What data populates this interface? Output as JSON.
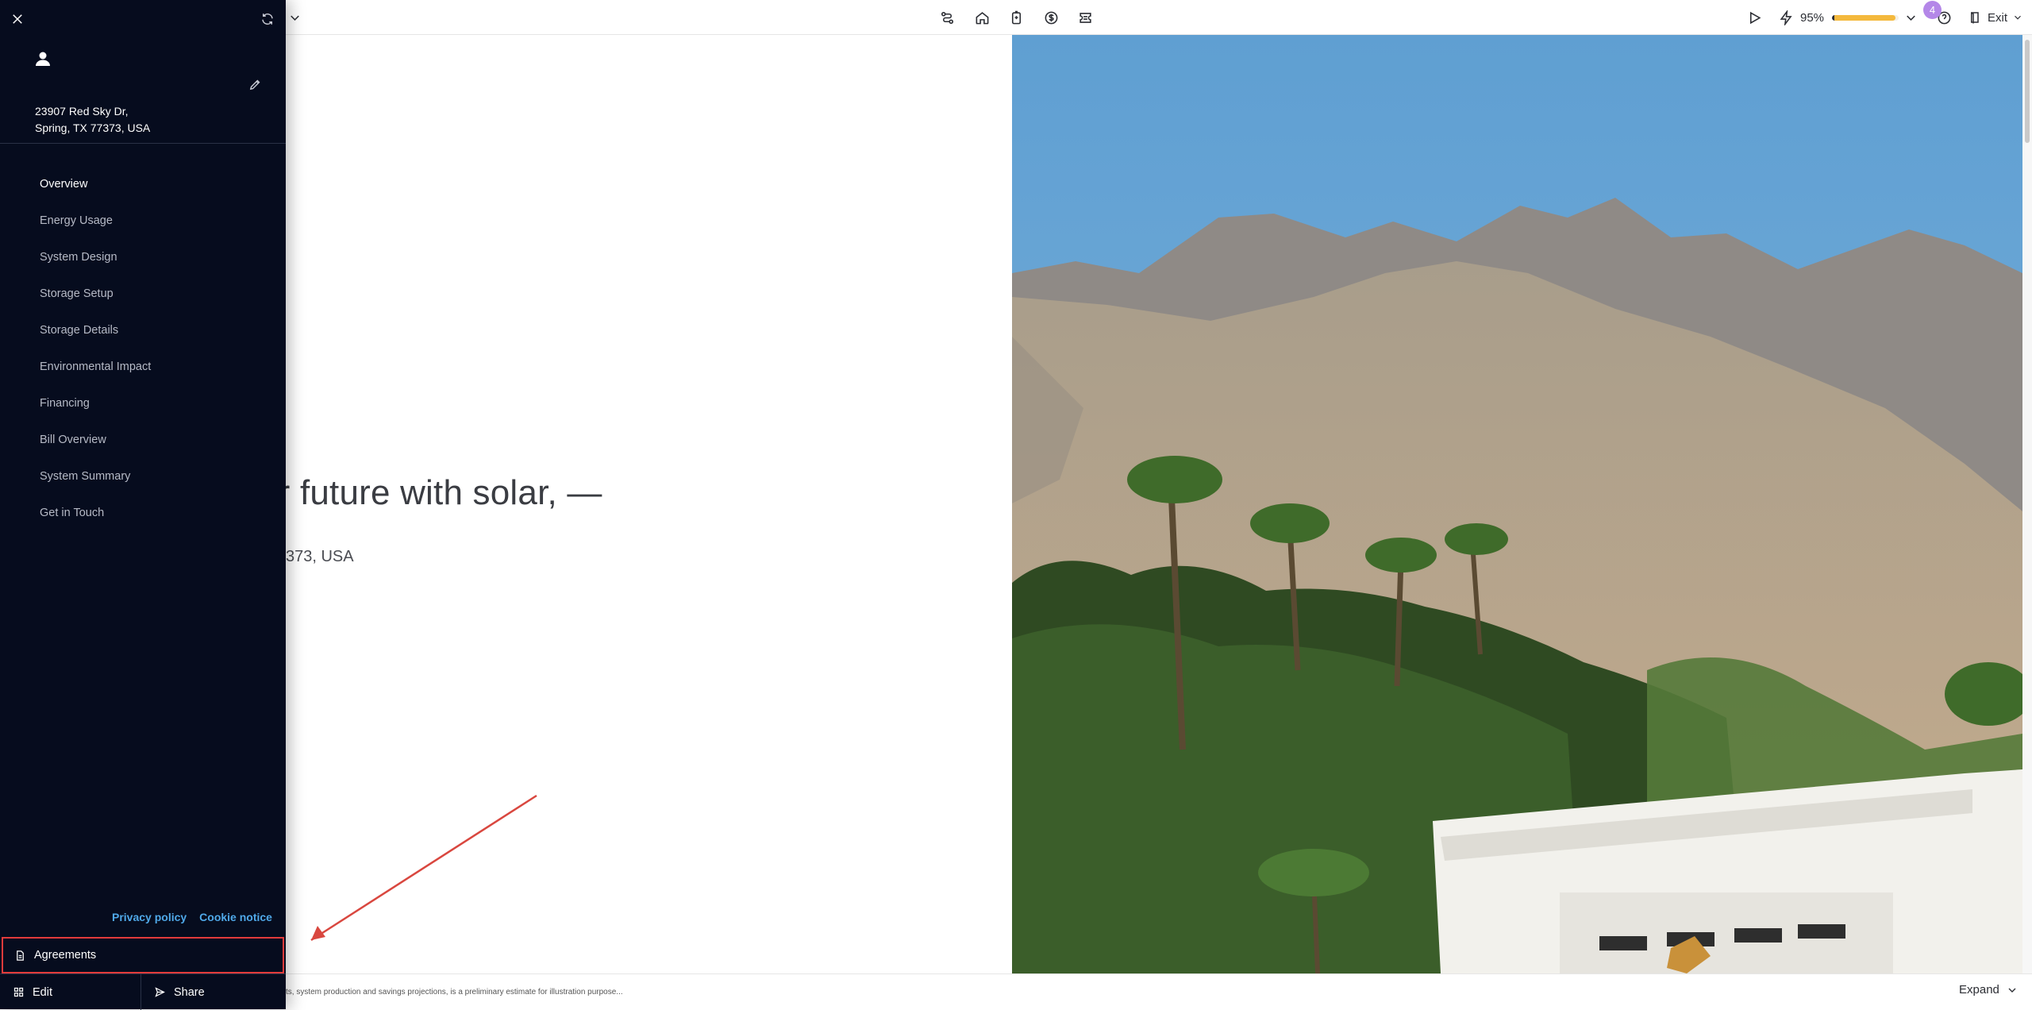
{
  "topbar": {
    "zoom": "95%",
    "progress_fraction": 0.95,
    "notification_count": "4",
    "exit_label": "Exit",
    "icons": [
      "chevron-down-icon",
      "route-icon",
      "home-icon",
      "battery-icon",
      "dollar-icon",
      "ticket-icon",
      "play-icon",
      "lightning-icon",
      "chevron-down-icon",
      "help-icon",
      "exit-icon"
    ]
  },
  "sidebar": {
    "address_line1": "23907 Red Sky Dr,",
    "address_line2": "Spring, TX 77373, USA",
    "nav": [
      {
        "label": "Overview",
        "active": true
      },
      {
        "label": "Energy Usage"
      },
      {
        "label": "System Design"
      },
      {
        "label": "Storage Setup"
      },
      {
        "label": "Storage Details"
      },
      {
        "label": "Environmental Impact"
      },
      {
        "label": "Financing"
      },
      {
        "label": "Bill Overview"
      },
      {
        "label": "System Summary"
      },
      {
        "label": "Get in Touch"
      }
    ],
    "privacy_label": "Privacy policy",
    "cookie_label": "Cookie notice",
    "agreements_label": "Agreements",
    "edit_label": "Edit",
    "share_label": "Share"
  },
  "main": {
    "headline_visible": "ur future with solar, —",
    "address_visible": "373, USA",
    "disclaimer_visible": "ts, system production and savings projections, is a preliminary estimate for illustration purpose...",
    "expand_label": "Expand"
  },
  "colors": {
    "sidebar_bg": "#060c1e",
    "link": "#4fa8e8",
    "highlight_border": "#e23b3b",
    "progress": "#f4b93d",
    "badge": "#b487e8"
  }
}
